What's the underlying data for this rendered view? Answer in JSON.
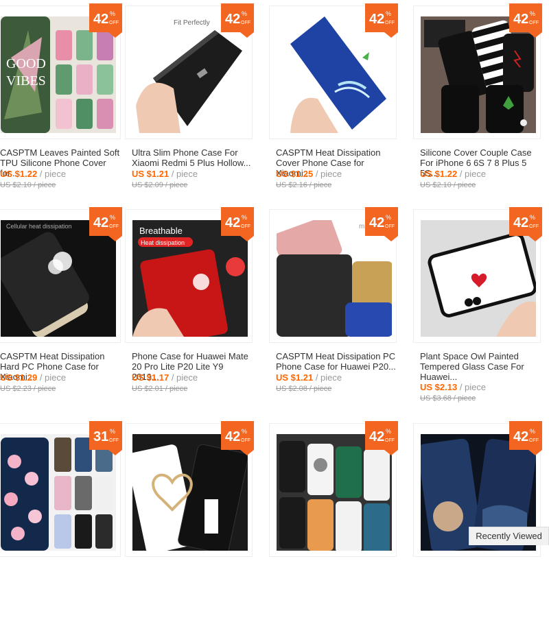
{
  "badge_suffix": "OFF",
  "badge_pct": "%",
  "colors": {
    "badge": "#f26622",
    "price": "#ff6600",
    "text": "#333333"
  },
  "recently_viewed": "Recently Viewed",
  "products": [
    {
      "title": "CASPTM Leaves Painted Soft TPU Silicone Phone Cover for...",
      "price": "US $1.22",
      "unit": "/ piece",
      "orig": "US $2.10 / piece",
      "discount": "42",
      "scene": "plant"
    },
    {
      "title": "Ultra Slim Phone Case For Xiaomi Redmi 5 Plus Hollow...",
      "price": "US $1.21",
      "unit": "/ piece",
      "orig": "US $2.09 / piece",
      "discount": "42",
      "scene": "black",
      "caption": "Fit Perfectly"
    },
    {
      "title": "CASPTM Heat Dissipation Cover Phone Case for Xiaomi...",
      "price": "US $1.25",
      "unit": "/ piece",
      "orig": "US $2.16 / piece",
      "discount": "42",
      "scene": "blue"
    },
    {
      "title": "Silicone Cover Couple Case For iPhone 6 6S 7 8 Plus 5 5S...",
      "price": "US $1.22",
      "unit": "/ piece",
      "orig": "US $2.10 / piece",
      "discount": "42",
      "scene": "couple"
    },
    {
      "title": "CASPTM Heat Dissipation Hard PC Phone Case for Xiaomi...",
      "price": "US $1.29",
      "unit": "/ piece",
      "orig": "US $2.23 / piece",
      "discount": "42",
      "scene": "dissipation",
      "caption": "Cellular heat dissipation"
    },
    {
      "title": "Phone Case for Huawei Mate 20 Pro Lite P20 Lite Y9 2019...",
      "price": "US $1.17",
      "unit": "/ piece",
      "orig": "US $2.01 / piece",
      "discount": "42",
      "scene": "red",
      "caption": "Breathable",
      "caption2": "Heat dissipation"
    },
    {
      "title": "CASPTM Heat Dissipation PC Phone Case for Huawei P20...",
      "price": "US $1.21",
      "unit": "/ piece",
      "orig": "US $2.08 / piece",
      "discount": "42",
      "scene": "multi",
      "caption": "multic"
    },
    {
      "title": "Plant Space Owl Painted Tempered Glass Case For Huawei...",
      "price": "US $2.13",
      "unit": "/ piece",
      "orig": "US $3.68 / piece",
      "discount": "42",
      "scene": "white"
    },
    {
      "title": "",
      "price": "",
      "unit": "",
      "orig": "",
      "discount": "31",
      "scene": "floral"
    },
    {
      "title": "",
      "price": "",
      "unit": "",
      "orig": "",
      "discount": "42",
      "scene": "heart"
    },
    {
      "title": "",
      "price": "",
      "unit": "",
      "orig": "",
      "discount": "42",
      "scene": "cats"
    },
    {
      "title": "",
      "price": "",
      "unit": "",
      "orig": "",
      "discount": "42",
      "scene": "space"
    }
  ]
}
